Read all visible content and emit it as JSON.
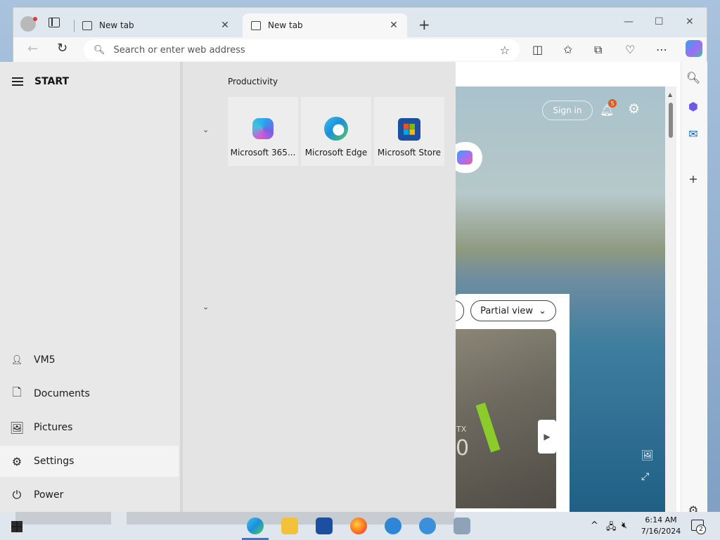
{
  "browser": {
    "tabs": [
      {
        "title": "New tab"
      },
      {
        "title": "New tab"
      }
    ],
    "address_placeholder": "Search or enter web address",
    "sign_in": "Sign in",
    "notification_count": "5",
    "feed_view_label": "Partial view",
    "gpu_text_1": "TX",
    "gpu_text_2": "0"
  },
  "start_menu": {
    "title": "START",
    "group_title": "Productivity",
    "tiles": [
      {
        "label": "Microsoft 365...",
        "icon": "microsoft-365-icon"
      },
      {
        "label": "Microsoft Edge",
        "icon": "edge-icon"
      },
      {
        "label": "Microsoft Store",
        "icon": "store-icon"
      }
    ],
    "items": [
      {
        "label": "VM5",
        "icon": "user-icon"
      },
      {
        "label": "Documents",
        "icon": "document-icon"
      },
      {
        "label": "Pictures",
        "icon": "pictures-icon"
      },
      {
        "label": "Settings",
        "icon": "gear-icon"
      },
      {
        "label": "Power",
        "icon": "power-icon"
      }
    ]
  },
  "taskbar": {
    "time": "6:14 AM",
    "date": "7/16/2024",
    "notification_count": "2"
  },
  "colors": {
    "accent": "#2d7dd2",
    "badge": "#e25a1c"
  }
}
